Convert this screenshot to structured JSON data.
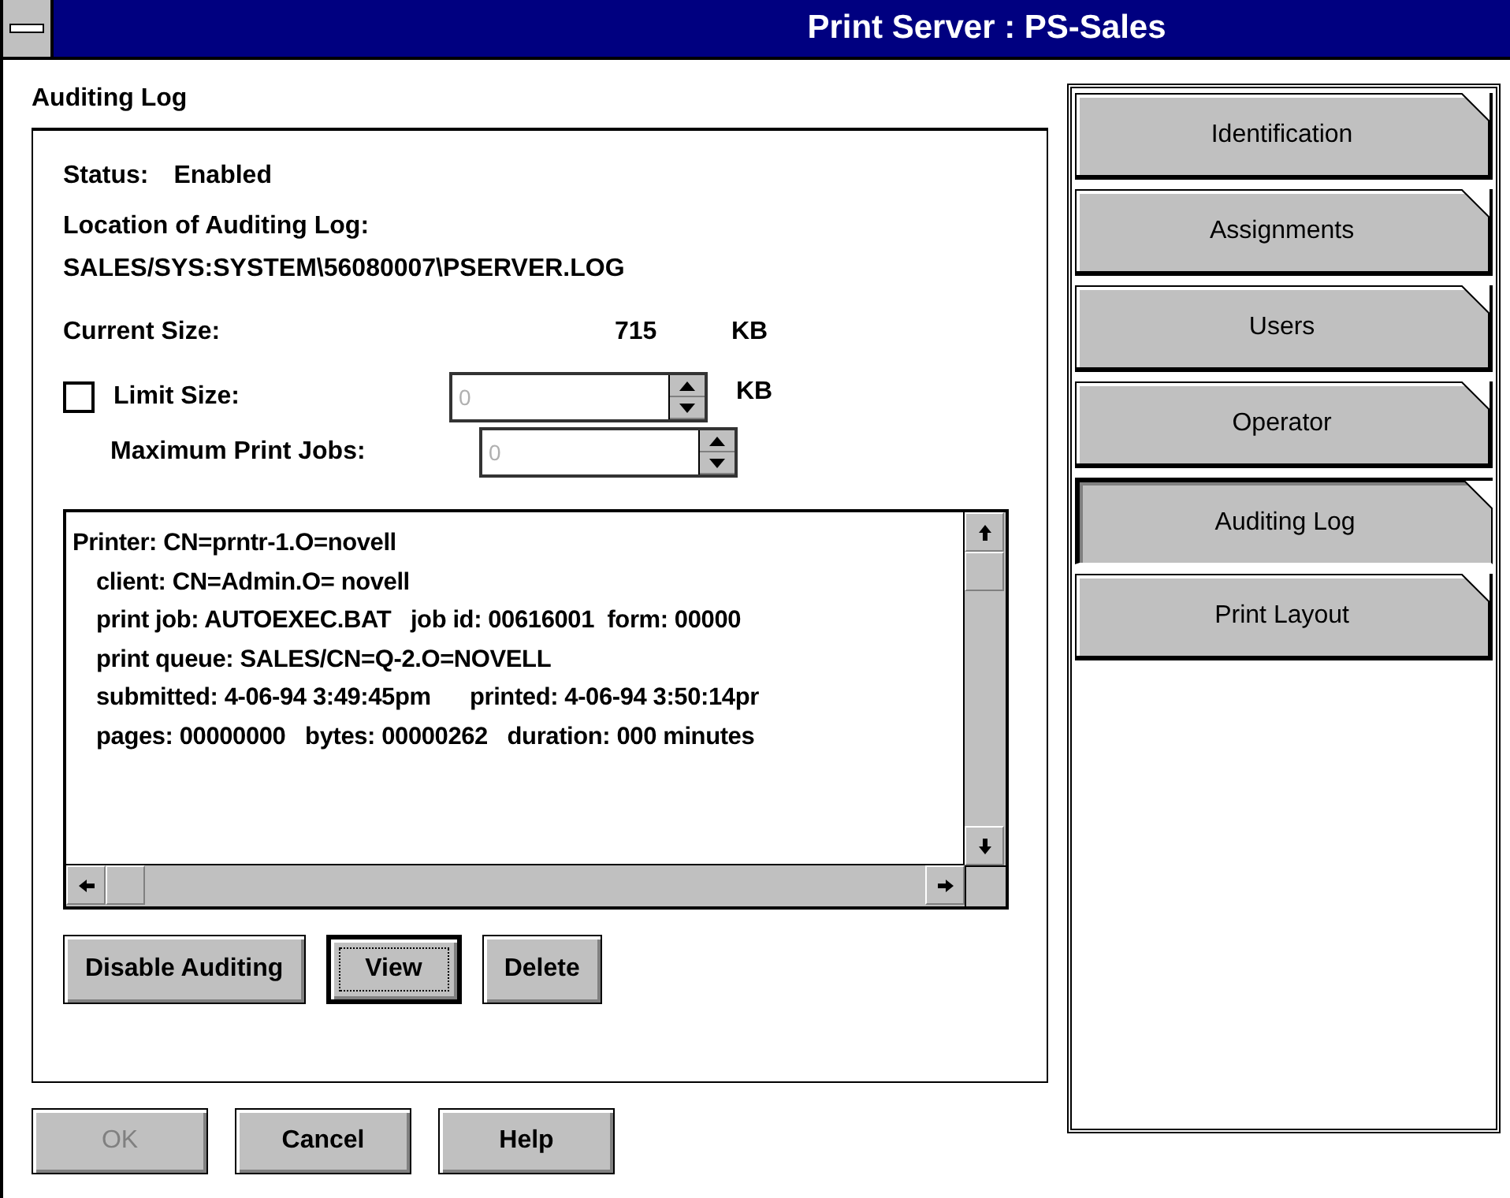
{
  "window": {
    "title": "Print Server : PS-Sales"
  },
  "panel": {
    "title": "Auditing Log",
    "status": {
      "label": "Status:",
      "value": "Enabled"
    },
    "location": {
      "label": "Location of Auditing Log:",
      "value": "SALES/SYS:SYSTEM\\56080007\\PSERVER.LOG"
    },
    "current_size": {
      "label": "Current Size:",
      "value": "715",
      "unit": "KB"
    },
    "limit_size": {
      "label": "Limit Size:",
      "checked": false,
      "value": "0",
      "unit": "KB",
      "disabled": true
    },
    "max_jobs": {
      "label": "Maximum Print Jobs:",
      "value": "0",
      "disabled": true
    },
    "log_lines": [
      {
        "text": "Printer: CN=prntr-1.O=novell",
        "indented": false
      },
      {
        "text": "client: CN=Admin.O= novell",
        "indented": true
      },
      {
        "text": "print job: AUTOEXEC.BAT   job id: 00616001  form: 00000",
        "indented": true
      },
      {
        "text": "print queue: SALES/CN=Q-2.O=NOVELL",
        "indented": true
      },
      {
        "text": "submitted: 4-06-94 3:49:45pm      printed: 4-06-94 3:50:14pr",
        "indented": true
      },
      {
        "text": "pages: 00000000   bytes: 00000262   duration: 000 minutes",
        "indented": true
      }
    ],
    "buttons": [
      {
        "label": "Disable Auditing",
        "default": false
      },
      {
        "label": "View",
        "default": true
      },
      {
        "label": "Delete",
        "default": false
      }
    ]
  },
  "tabs": [
    {
      "label": "Identification",
      "selected": false
    },
    {
      "label": "Assignments",
      "selected": false
    },
    {
      "label": "Users",
      "selected": false
    },
    {
      "label": "Operator",
      "selected": false
    },
    {
      "label": "Auditing Log",
      "selected": true
    },
    {
      "label": "Print Layout",
      "selected": false
    }
  ],
  "footer_buttons": [
    {
      "label": "OK",
      "disabled": true
    },
    {
      "label": "Cancel",
      "disabled": false
    },
    {
      "label": "Help",
      "disabled": false
    }
  ]
}
